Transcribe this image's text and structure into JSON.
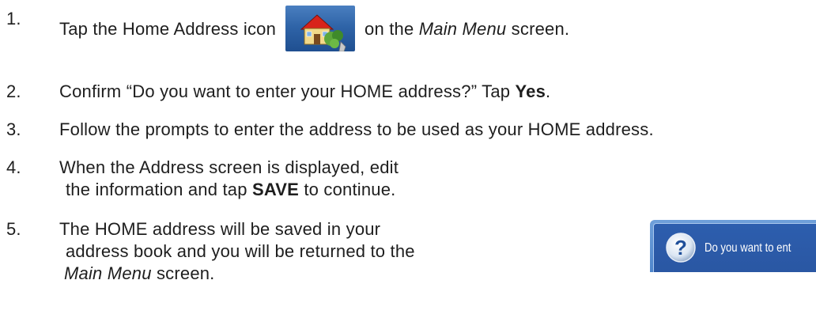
{
  "steps": [
    {
      "num": "1.",
      "before": "Tap the Home Address icon",
      "after_em": "Main Menu",
      "after_prefix": "on the ",
      "after_suffix": " screen."
    },
    {
      "num": "2.",
      "before": "Confirm “Do you want to enter your HOME address?”  Tap ",
      "bold": "Yes",
      "after": "."
    },
    {
      "num": "3.",
      "text": "Follow the prompts to enter the address to be used as your HOME address."
    },
    {
      "num": "4.",
      "line1": "When the Address screen is displayed, edit",
      "line2_before": "the information and tap ",
      "line2_bold": "SAVE",
      "line2_after": " to continue."
    },
    {
      "num": "5.",
      "line1": "The HOME address will be saved in your",
      "line2": "address book and you will be returned to the",
      "line3_em": "Main Menu",
      "line3_after": " screen."
    }
  ],
  "dialog": {
    "icon": "question-icon",
    "text": "Do you want to ent"
  },
  "icons": {
    "home": "home-address-icon"
  },
  "colors": {
    "dialog_bg": "#2d5eae",
    "icon_bg": "#2f64a8"
  }
}
